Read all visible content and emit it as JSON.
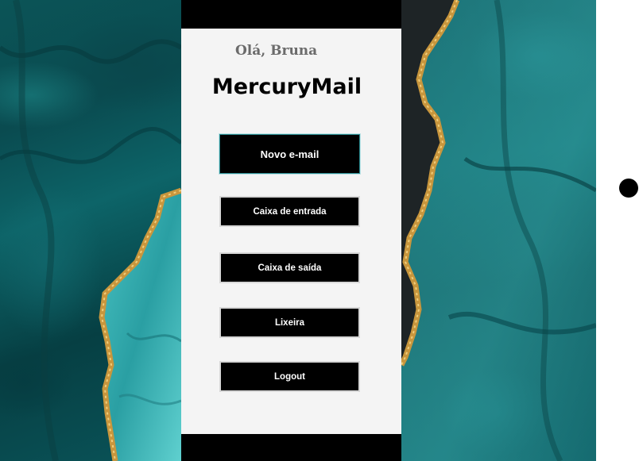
{
  "greeting": "Olá, Bruna",
  "app_title": "MercuryMail",
  "menu": {
    "new_email": "Novo e-mail",
    "inbox": "Caixa de entrada",
    "outbox": "Caixa de saída",
    "trash": "Lixeira",
    "logout": "Logout"
  },
  "colors": {
    "teal_marble": "#0b5457",
    "light_teal": "#3fb6b8",
    "gold_vein": "#b88a3a",
    "panel": "#f4f4f4",
    "button": "#000000"
  },
  "icons": [
    "status-dot"
  ]
}
